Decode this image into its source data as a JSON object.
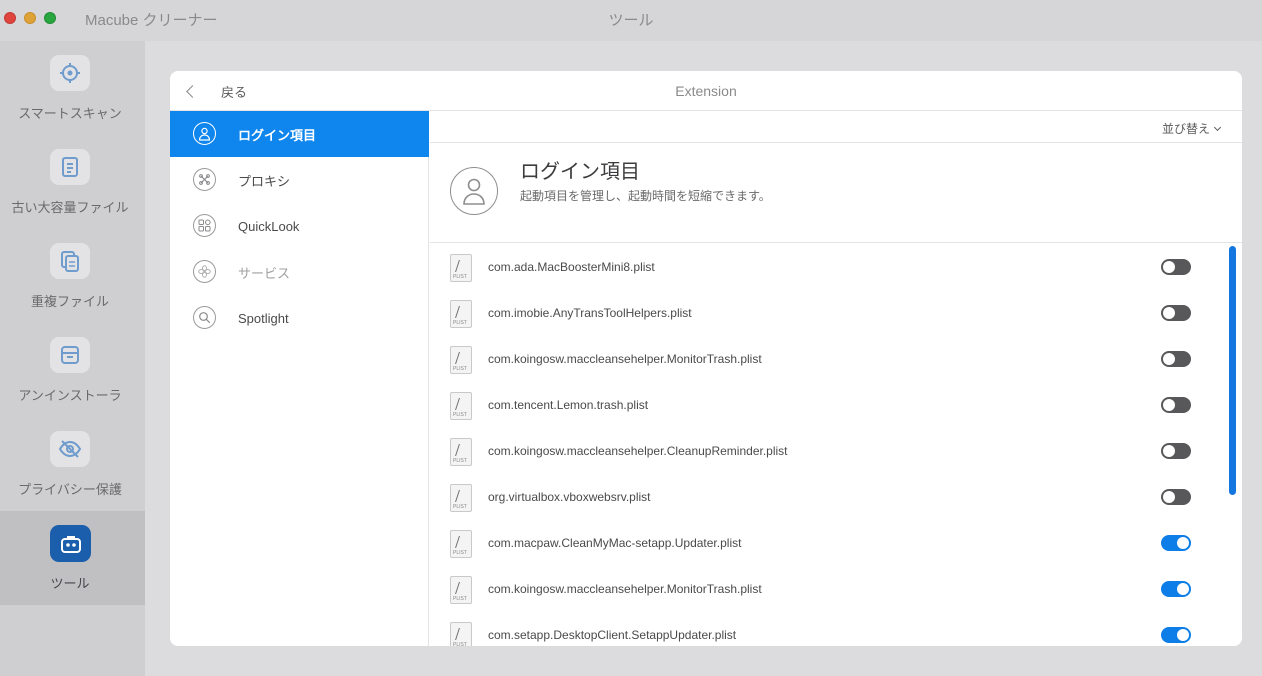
{
  "window": {
    "app_title": "Macube クリーナー",
    "title": "ツール"
  },
  "rail": {
    "items": [
      {
        "label": "スマートスキャン",
        "icon": "target-icon"
      },
      {
        "label": "古い大容量ファイル",
        "icon": "document-icon"
      },
      {
        "label": "重複ファイル",
        "icon": "duplicate-icon"
      },
      {
        "label": "アンインストーラ",
        "icon": "archive-icon"
      },
      {
        "label": "プライバシー保護",
        "icon": "eye-slash-icon"
      },
      {
        "label": "ツール",
        "icon": "toolbox-icon",
        "active": true
      }
    ]
  },
  "modal": {
    "back_label": "戻る",
    "title": "Extension",
    "categories": [
      {
        "label": "ログイン項目",
        "icon": "user-icon",
        "active": true
      },
      {
        "label": "プロキシ",
        "icon": "cross-icon"
      },
      {
        "label": "QuickLook",
        "icon": "grid-icon"
      },
      {
        "label": "サービス",
        "icon": "fan-icon",
        "dimmed": true
      },
      {
        "label": "Spotlight",
        "icon": "magnifier-icon"
      }
    ],
    "sort_label": "並び替え",
    "hero": {
      "title": "ログイン項目",
      "description": "起動項目を管理し、起動時間を短縮できます。"
    },
    "items": [
      {
        "name": "com.ada.MacBoosterMini8.plist",
        "enabled": false
      },
      {
        "name": "com.imobie.AnyTransToolHelpers.plist",
        "enabled": false
      },
      {
        "name": "com.koingosw.maccleansehelper.MonitorTrash.plist",
        "enabled": false
      },
      {
        "name": "com.tencent.Lemon.trash.plist",
        "enabled": false
      },
      {
        "name": "com.koingosw.maccleansehelper.CleanupReminder.plist",
        "enabled": false
      },
      {
        "name": "org.virtualbox.vboxwebsrv.plist",
        "enabled": false
      },
      {
        "name": "com.macpaw.CleanMyMac-setapp.Updater.plist",
        "enabled": true
      },
      {
        "name": "com.koingosw.maccleansehelper.MonitorTrash.plist",
        "enabled": true
      },
      {
        "name": "com.setapp.DesktopClient.SetappUpdater.plist",
        "enabled": true
      }
    ]
  },
  "colors": {
    "accent": "#0f86ee",
    "toggle_off": "#58585a",
    "toggle_on": "#0d7ee8",
    "rail_active_icon": "#1a5eac"
  }
}
